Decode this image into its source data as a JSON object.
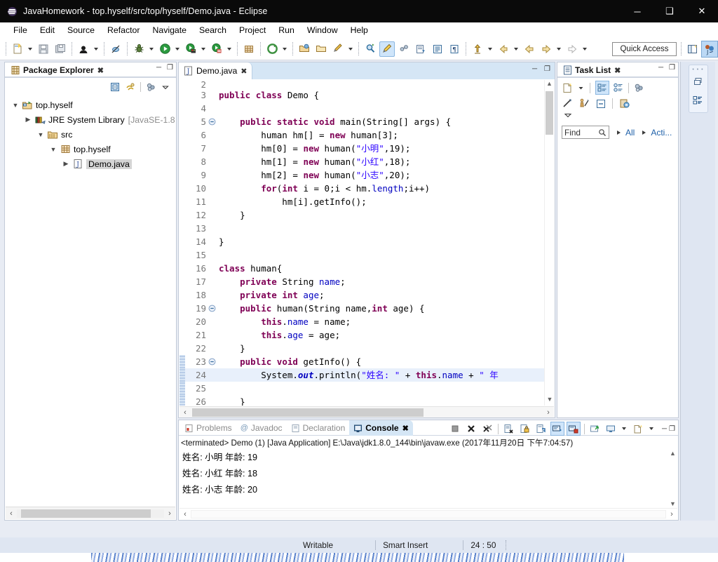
{
  "window": {
    "title": "JavaHomework - top.hyself/src/top/hyself/Demo.java - Eclipse",
    "app_icon": "eclipse-icon",
    "minimize_label": "─",
    "maximize_label": "❑",
    "close_label": "✕"
  },
  "menubar": {
    "items": [
      {
        "label": "File"
      },
      {
        "label": "Edit"
      },
      {
        "label": "Source"
      },
      {
        "label": "Refactor"
      },
      {
        "label": "Navigate"
      },
      {
        "label": "Search"
      },
      {
        "label": "Project"
      },
      {
        "label": "Run"
      },
      {
        "label": "Window"
      },
      {
        "label": "Help"
      }
    ]
  },
  "toolbar": {
    "quick_access_label": "Quick Access",
    "buttons": [
      {
        "name": "new-wizard-icon"
      },
      {
        "name": "save-icon"
      },
      {
        "name": "save-all-icon"
      },
      {
        "name": "skip-breakpoints-icon"
      },
      {
        "name": "toggle-breakpoint-icon"
      },
      {
        "name": "debug-icon"
      },
      {
        "name": "run-icon"
      },
      {
        "name": "coverage-icon"
      },
      {
        "name": "external-tools-icon"
      },
      {
        "name": "new-java-package-icon"
      },
      {
        "name": "new-java-project-icon"
      },
      {
        "name": "open-type-icon"
      },
      {
        "name": "open-task-icon"
      },
      {
        "name": "search-icon"
      },
      {
        "name": "pin-icon"
      },
      {
        "name": "highlight-icon"
      },
      {
        "name": "link-icon"
      },
      {
        "name": "next-annotation-icon"
      },
      {
        "name": "previous-annotation-icon"
      },
      {
        "name": "last-edit-icon"
      },
      {
        "name": "back-icon"
      },
      {
        "name": "forward-icon"
      }
    ]
  },
  "package_explorer": {
    "title": "Package Explorer",
    "close_label": "✖",
    "minimize_label": "─",
    "maximize_label": "❐",
    "toolbar_icons": [
      "collapse-all-icon",
      "link-with-editor-icon",
      "view-menu-filter-icon",
      "view-menu-icon"
    ],
    "tree": [
      {
        "indent": 0,
        "twisty": "down",
        "icon": "java-project-icon",
        "label": "top.hyself",
        "gray": false,
        "selected": false
      },
      {
        "indent": 1,
        "twisty": "right",
        "icon": "jre-library-icon",
        "label": "JRE System Library",
        "suffix": "[JavaSE-1.8",
        "gray": false,
        "selected": false
      },
      {
        "indent": 1,
        "twisty": "down",
        "icon": "source-folder-icon",
        "label": "src",
        "gray": false,
        "selected": false
      },
      {
        "indent": 2,
        "twisty": "down",
        "icon": "package-icon",
        "label": "top.hyself",
        "gray": false,
        "selected": false
      },
      {
        "indent": 3,
        "twisty": "right",
        "icon": "java-file-icon",
        "label": "Demo.java",
        "gray": false,
        "selected": true
      }
    ]
  },
  "editor": {
    "tab_label": "Demo.java",
    "tab_icon": "java-file-icon",
    "tab_close_label": "✖",
    "minimize_label": "─",
    "maximize_label": "❐",
    "lines": [
      {
        "num": "2",
        "fold": "",
        "partial": true,
        "highlight": false,
        "tokens": []
      },
      {
        "num": "3",
        "fold": "",
        "highlight": false,
        "tokens": [
          {
            "t": "kw",
            "v": "public "
          },
          {
            "t": "kw",
            "v": "class "
          },
          {
            "t": "plain",
            "v": "Demo {"
          }
        ]
      },
      {
        "num": "4",
        "fold": "",
        "highlight": false,
        "tokens": []
      },
      {
        "num": "5",
        "fold": "minus",
        "highlight": false,
        "tokens": [
          {
            "t": "plain",
            "v": "    "
          },
          {
            "t": "kw",
            "v": "public static void "
          },
          {
            "t": "plain",
            "v": "main(String[] args) {"
          }
        ]
      },
      {
        "num": "6",
        "fold": "",
        "highlight": false,
        "tokens": [
          {
            "t": "plain",
            "v": "        human hm[] = "
          },
          {
            "t": "kw",
            "v": "new "
          },
          {
            "t": "plain",
            "v": "human["
          },
          {
            "t": "num",
            "v": "3"
          },
          {
            "t": "plain",
            "v": "];"
          }
        ]
      },
      {
        "num": "7",
        "fold": "",
        "highlight": false,
        "tokens": [
          {
            "t": "plain",
            "v": "        hm["
          },
          {
            "t": "num",
            "v": "0"
          },
          {
            "t": "plain",
            "v": "] = "
          },
          {
            "t": "kw",
            "v": "new "
          },
          {
            "t": "plain",
            "v": "human("
          },
          {
            "t": "str",
            "v": "\"小明\""
          },
          {
            "t": "plain",
            "v": ","
          },
          {
            "t": "num",
            "v": "19"
          },
          {
            "t": "plain",
            "v": ");"
          }
        ]
      },
      {
        "num": "8",
        "fold": "",
        "highlight": false,
        "tokens": [
          {
            "t": "plain",
            "v": "        hm["
          },
          {
            "t": "num",
            "v": "1"
          },
          {
            "t": "plain",
            "v": "] = "
          },
          {
            "t": "kw",
            "v": "new "
          },
          {
            "t": "plain",
            "v": "human("
          },
          {
            "t": "str",
            "v": "\"小红\""
          },
          {
            "t": "plain",
            "v": ","
          },
          {
            "t": "num",
            "v": "18"
          },
          {
            "t": "plain",
            "v": ");"
          }
        ]
      },
      {
        "num": "9",
        "fold": "",
        "highlight": false,
        "tokens": [
          {
            "t": "plain",
            "v": "        hm["
          },
          {
            "t": "num",
            "v": "2"
          },
          {
            "t": "plain",
            "v": "] = "
          },
          {
            "t": "kw",
            "v": "new "
          },
          {
            "t": "plain",
            "v": "human("
          },
          {
            "t": "str",
            "v": "\"小志\""
          },
          {
            "t": "plain",
            "v": ","
          },
          {
            "t": "num",
            "v": "20"
          },
          {
            "t": "plain",
            "v": ");"
          }
        ]
      },
      {
        "num": "10",
        "fold": "",
        "highlight": false,
        "tokens": [
          {
            "t": "plain",
            "v": "        "
          },
          {
            "t": "kw",
            "v": "for"
          },
          {
            "t": "plain",
            "v": "("
          },
          {
            "t": "kw",
            "v": "int "
          },
          {
            "t": "plain",
            "v": "i = "
          },
          {
            "t": "num",
            "v": "0"
          },
          {
            "t": "plain",
            "v": ";i < hm."
          },
          {
            "t": "fld",
            "v": "length"
          },
          {
            "t": "plain",
            "v": ";i++)"
          }
        ]
      },
      {
        "num": "11",
        "fold": "",
        "highlight": false,
        "tokens": [
          {
            "t": "plain",
            "v": "            hm[i].getInfo();"
          }
        ]
      },
      {
        "num": "12",
        "fold": "",
        "highlight": false,
        "tokens": [
          {
            "t": "plain",
            "v": "    }"
          }
        ]
      },
      {
        "num": "13",
        "fold": "",
        "highlight": false,
        "tokens": []
      },
      {
        "num": "14",
        "fold": "",
        "highlight": false,
        "tokens": [
          {
            "t": "plain",
            "v": "}"
          }
        ]
      },
      {
        "num": "15",
        "fold": "",
        "highlight": false,
        "tokens": []
      },
      {
        "num": "16",
        "fold": "",
        "highlight": false,
        "tokens": [
          {
            "t": "kw",
            "v": "class "
          },
          {
            "t": "plain",
            "v": "human{"
          }
        ]
      },
      {
        "num": "17",
        "fold": "",
        "highlight": false,
        "tokens": [
          {
            "t": "plain",
            "v": "    "
          },
          {
            "t": "kw",
            "v": "private "
          },
          {
            "t": "plain",
            "v": "String "
          },
          {
            "t": "fld",
            "v": "name"
          },
          {
            "t": "plain",
            "v": ";"
          }
        ]
      },
      {
        "num": "18",
        "fold": "",
        "highlight": false,
        "tokens": [
          {
            "t": "plain",
            "v": "    "
          },
          {
            "t": "kw",
            "v": "private int "
          },
          {
            "t": "fld",
            "v": "age"
          },
          {
            "t": "plain",
            "v": ";"
          }
        ]
      },
      {
        "num": "19",
        "fold": "minus",
        "highlight": false,
        "tokens": [
          {
            "t": "plain",
            "v": "    "
          },
          {
            "t": "kw",
            "v": "public "
          },
          {
            "t": "plain",
            "v": "human(String name,"
          },
          {
            "t": "kw",
            "v": "int "
          },
          {
            "t": "plain",
            "v": "age) {"
          }
        ]
      },
      {
        "num": "20",
        "fold": "",
        "highlight": false,
        "tokens": [
          {
            "t": "plain",
            "v": "        "
          },
          {
            "t": "kw",
            "v": "this"
          },
          {
            "t": "plain",
            "v": "."
          },
          {
            "t": "fld",
            "v": "name"
          },
          {
            "t": "plain",
            "v": " = name;"
          }
        ]
      },
      {
        "num": "21",
        "fold": "",
        "highlight": false,
        "tokens": [
          {
            "t": "plain",
            "v": "        "
          },
          {
            "t": "kw",
            "v": "this"
          },
          {
            "t": "plain",
            "v": "."
          },
          {
            "t": "fld",
            "v": "age"
          },
          {
            "t": "plain",
            "v": " = age;"
          }
        ]
      },
      {
        "num": "22",
        "fold": "",
        "highlight": false,
        "tokens": [
          {
            "t": "plain",
            "v": "    }"
          }
        ]
      },
      {
        "num": "23",
        "fold": "minus",
        "highlight": false,
        "marker": true,
        "tokens": [
          {
            "t": "plain",
            "v": "    "
          },
          {
            "t": "kw",
            "v": "public void "
          },
          {
            "t": "plain",
            "v": "getInfo() {"
          }
        ]
      },
      {
        "num": "24",
        "fold": "",
        "highlight": true,
        "marker": true,
        "tokens": [
          {
            "t": "plain",
            "v": "        System."
          },
          {
            "t": "sfld",
            "v": "out"
          },
          {
            "t": "plain",
            "v": ".println("
          },
          {
            "t": "str",
            "v": "\"姓名: \""
          },
          {
            "t": "plain",
            "v": " + "
          },
          {
            "t": "kw",
            "v": "this"
          },
          {
            "t": "plain",
            "v": "."
          },
          {
            "t": "fld",
            "v": "name"
          },
          {
            "t": "plain",
            "v": " + "
          },
          {
            "t": "str",
            "v": "\" 年"
          }
        ]
      },
      {
        "num": "25",
        "fold": "",
        "highlight": false,
        "marker": true,
        "tokens": []
      },
      {
        "num": "26",
        "fold": "",
        "highlight": false,
        "marker": true,
        "tokens": [
          {
            "t": "plain",
            "v": "    }"
          }
        ]
      }
    ]
  },
  "console": {
    "tabs": [
      {
        "label": "Problems",
        "icon": "problems-icon",
        "active": false
      },
      {
        "label": "Javadoc",
        "icon": "javadoc-icon",
        "active": false
      },
      {
        "label": "Declaration",
        "icon": "declaration-icon",
        "active": false
      },
      {
        "label": "Console",
        "icon": "console-icon",
        "active": true
      }
    ],
    "close_label": "✖",
    "minimize_label": "─",
    "maximize_label": "❐",
    "launch_header": "<terminated> Demo (1) [Java Application] E:\\Java\\jdk1.8.0_144\\bin\\javaw.exe (2017年11月20日 下午7:04:57)",
    "output_lines": [
      "姓名: 小明 年龄: 19",
      "姓名: 小红 年龄: 18",
      "姓名: 小志 年龄: 20"
    ],
    "toolbar_icons": [
      "terminate-icon",
      "remove-launch-icon",
      "remove-all-launches-icon",
      "clear-console-icon",
      "scroll-lock-icon",
      "word-wrap-icon",
      "show-console-on-output-icon",
      "pin-console-icon",
      "display-selected-console-icon",
      "open-console-icon"
    ]
  },
  "task_list": {
    "title": "Task List",
    "close_label": "✖",
    "minimize_label": "─",
    "maximize_label": "❐",
    "find_placeholder": "Find",
    "filter_all": "All",
    "filter_activate": "Acti...",
    "toolbar_icons": [
      "new-task-icon",
      "categorized-icon",
      "scheduled-icon",
      "focus-on-workweek-icon",
      "synchronize-changed-icon",
      "collapse-all-icon",
      "restore-icon",
      "view-menu-icon"
    ]
  },
  "perspective_strip": {
    "buttons": [
      "restore-perspective-icon",
      "java-perspective-icon"
    ]
  },
  "statusbar": {
    "writable": "Writable",
    "insert_mode": "Smart Insert",
    "position": "24 : 50"
  },
  "colors": {
    "titlebar_bg": "#0a0a0a",
    "accent_tab": "#d5e6f5",
    "keyword": "#7f0055",
    "string": "#2a00ff",
    "field": "#0000c0",
    "selection": "#e8f0fb",
    "status_bg": "#dfe6f2"
  }
}
